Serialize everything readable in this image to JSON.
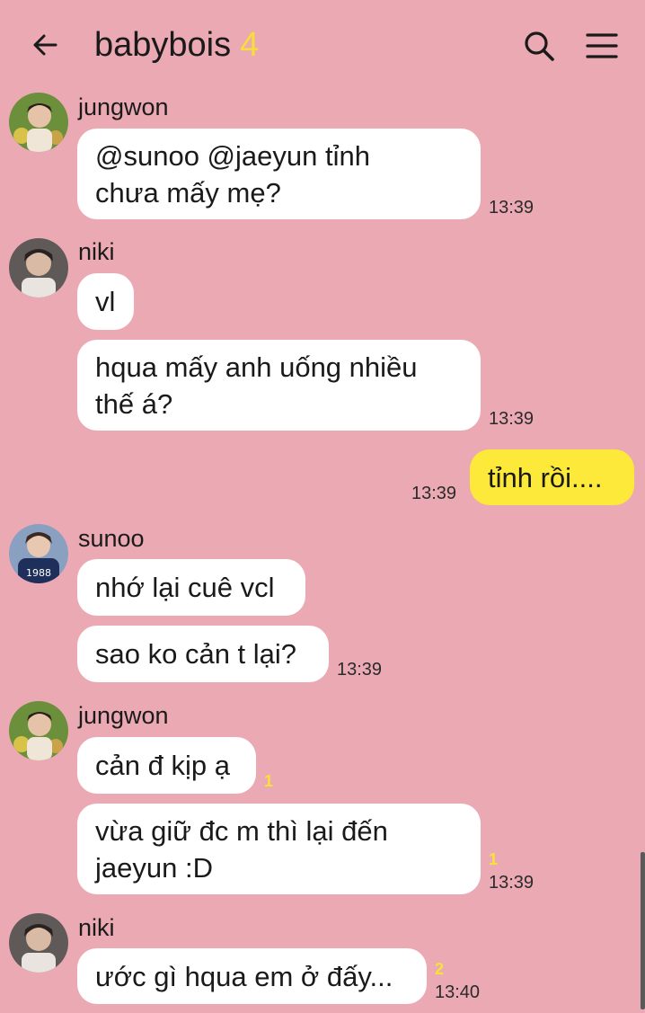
{
  "header": {
    "title": "babybois",
    "member_count": "4",
    "back_icon": "arrow-left-icon",
    "search_icon": "search-icon",
    "menu_icon": "hamburger-menu-icon"
  },
  "colors": {
    "background": "#eba9b3",
    "bubble_other": "#ffffff",
    "bubble_me": "#fde93a",
    "unread_count": "#f7e23a"
  },
  "messages": {
    "g1": {
      "sender": "jungwon",
      "time": "13:39",
      "b1": {
        "line1": "@sunoo @jaeyun tỉnh",
        "line2": "chưa mấy mẹ?"
      }
    },
    "g2": {
      "sender": "niki",
      "time": "13:39",
      "b1": {
        "text": "vl"
      },
      "b2": {
        "line1": "hqua mấy anh uống nhiều",
        "line2": "thế á?"
      }
    },
    "g3": {
      "sender": "me",
      "time": "13:39",
      "b1": {
        "text": "tỉnh rồi...."
      }
    },
    "g4": {
      "sender": "sunoo",
      "time": "13:39",
      "b1": {
        "text": "nhớ lại cuê vcl"
      },
      "b2": {
        "text": "sao ko cản t lại?"
      }
    },
    "g5": {
      "sender": "jungwon",
      "time": "13:39",
      "b1": {
        "text": "cản đ kịp ạ",
        "unread": "1"
      },
      "b2": {
        "line1": "vừa giữ đc m thì lại đến",
        "line2": "jaeyun :D",
        "unread": "1"
      }
    },
    "g6": {
      "sender": "niki",
      "time": "13:40",
      "b1": {
        "text": "ước gì hqua em ở đấy...",
        "unread": "2"
      }
    }
  }
}
